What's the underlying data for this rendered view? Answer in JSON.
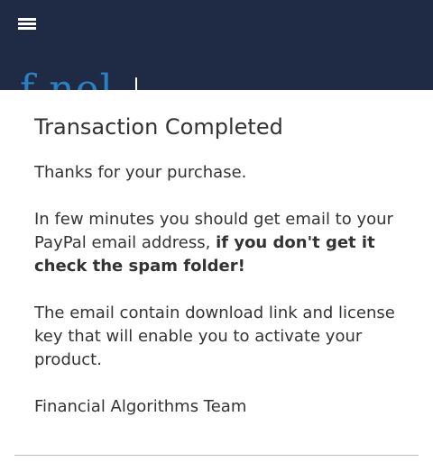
{
  "header": {
    "menu_icon": "hamburger-menu-icon",
    "logo_fragment": "f nel",
    "background_color": "#1f2a44"
  },
  "modal": {
    "title": "Transaction Completed",
    "thanks": "Thanks for your purchase.",
    "email_notice": "In few minutes you should get email to your PayPal email address, ",
    "email_notice_bold": "if you don't get it check the spam folder!",
    "download_info": "The email contain download link and license key that will enable you to activate your product.",
    "signature": "Financial Algorithms Team"
  }
}
